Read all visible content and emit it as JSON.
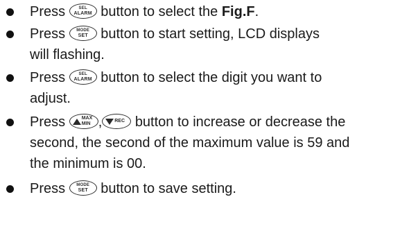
{
  "instructions": [
    {
      "press": "Press",
      "button": {
        "icon": "sel-alarm-button-icon",
        "line1": "SEL",
        "line2": "ALARM"
      },
      "after": "button to select the",
      "bold": "Fig.F",
      "end": "."
    },
    {
      "press": "Press",
      "button": {
        "icon": "mode-set-button-icon",
        "line1": "MODE",
        "line2": "SET"
      },
      "after": "button to start setting, LCD displays",
      "continuation": "will flashing."
    },
    {
      "press": "Press",
      "button": {
        "icon": "sel-alarm-button-icon",
        "line1": "SEL",
        "line2": "ALARM"
      },
      "after": "button to select the digit you want to",
      "continuation": "adjust."
    },
    {
      "press": "Press",
      "button_up": {
        "icon": "max-min-up-button-icon",
        "line1": "MAX",
        "line2": "MIN"
      },
      "separator": ",",
      "button_down": {
        "icon": "rec-down-button-icon",
        "line1": "REC"
      },
      "after": "button to increase or decrease the",
      "continuation_lines": [
        "second, the second of the maximum value is 59 and",
        "the minimum is 00."
      ]
    },
    {
      "press": "Press",
      "button": {
        "icon": "mode-set-button-icon",
        "line1": "MODE",
        "line2": "SET"
      },
      "after": "button to save setting."
    }
  ]
}
